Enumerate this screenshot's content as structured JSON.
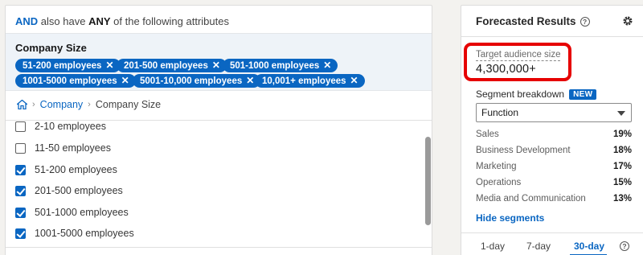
{
  "left": {
    "and_keyword": "AND",
    "also_have": "also have",
    "any_keyword": "ANY",
    "attr_suffix": "of the following attributes",
    "facet_title": "Company Size",
    "selected_pills": [
      "51-200 employees",
      "201-500 employees",
      "501-1000 employees",
      "1001-5000 employees",
      "5001-10,000 employees",
      "10,001+ employees"
    ],
    "breadcrumb": {
      "home_icon": "home-icon",
      "link": "Company",
      "current": "Company Size"
    },
    "options": [
      {
        "label": "2-10 employees",
        "checked": false
      },
      {
        "label": "11-50 employees",
        "checked": false
      },
      {
        "label": "51-200 employees",
        "checked": true
      },
      {
        "label": "201-500 employees",
        "checked": true
      },
      {
        "label": "501-1000 employees",
        "checked": true
      },
      {
        "label": "1001-5000 employees",
        "checked": true
      }
    ]
  },
  "right": {
    "title": "Forecasted Results",
    "target_audience_label": "Target audience size",
    "target_audience_value": "4,300,000+",
    "segment_label": "Segment breakdown",
    "new_badge": "NEW",
    "segment_select_value": "Function",
    "segments": [
      {
        "name": "Sales",
        "pct": "19%"
      },
      {
        "name": "Business Development",
        "pct": "18%"
      },
      {
        "name": "Marketing",
        "pct": "17%"
      },
      {
        "name": "Operations",
        "pct": "15%"
      },
      {
        "name": "Media and Communication",
        "pct": "13%"
      }
    ],
    "hide_segments": "Hide segments",
    "day_tabs": [
      "1-day",
      "7-day",
      "30-day"
    ],
    "active_tab": "30-day"
  },
  "colors": {
    "accent": "#0a66c2",
    "highlight": "#e60000"
  }
}
